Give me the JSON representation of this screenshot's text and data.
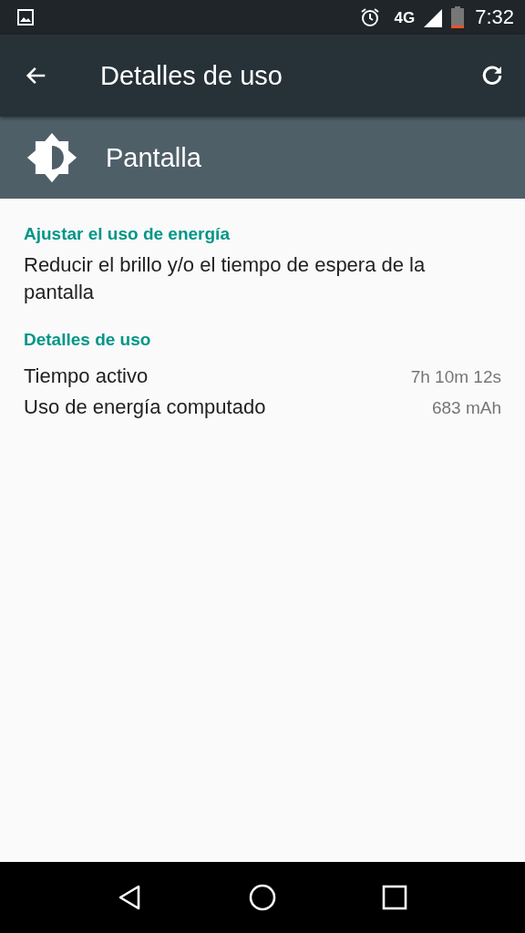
{
  "status_bar": {
    "network": "4G",
    "time": "7:32"
  },
  "app_bar": {
    "title": "Detalles de uso"
  },
  "header": {
    "title": "Pantalla"
  },
  "sections": [
    {
      "kind": "action",
      "title": "Ajustar el uso de energía",
      "text": "Reducir el brillo y/o el tiempo de espera de la pantalla"
    },
    {
      "kind": "details",
      "title": "Detalles de uso",
      "rows": [
        {
          "label": "Tiempo activo",
          "value": "7h 10m 12s"
        },
        {
          "label": "Uso de energía computado",
          "value": "683 mAh"
        }
      ]
    }
  ]
}
